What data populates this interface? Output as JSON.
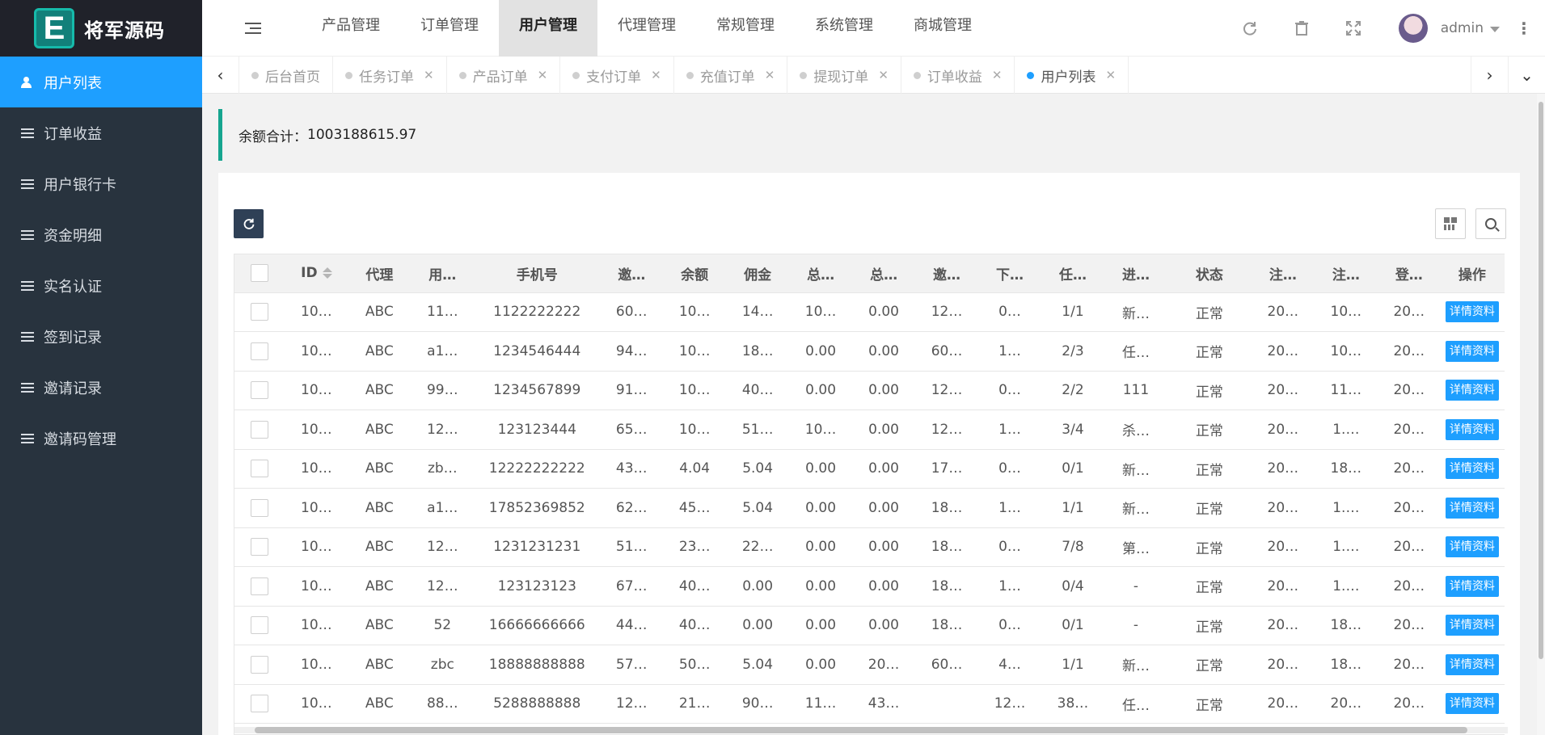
{
  "app": {
    "logo_letter": "E",
    "logo_text": "将军源码"
  },
  "sidebar": {
    "items": [
      {
        "label": "用户列表",
        "active": true
      },
      {
        "label": "订单收益"
      },
      {
        "label": "用户银行卡"
      },
      {
        "label": "资金明细"
      },
      {
        "label": "实名认证"
      },
      {
        "label": "签到记录"
      },
      {
        "label": "邀请记录"
      },
      {
        "label": "邀请码管理"
      }
    ]
  },
  "header": {
    "nav": [
      "产品管理",
      "订单管理",
      "用户管理",
      "代理管理",
      "常规管理",
      "系统管理",
      "商城管理"
    ],
    "active_nav": "用户管理",
    "username": "admin",
    "icons": [
      "refresh-icon",
      "trash-icon",
      "fullscreen-icon",
      "more-icon"
    ]
  },
  "tabs": [
    {
      "label": "后台首页",
      "closable": false
    },
    {
      "label": "任务订单",
      "closable": true
    },
    {
      "label": "产品订单",
      "closable": true
    },
    {
      "label": "支付订单",
      "closable": true
    },
    {
      "label": "充值订单",
      "closable": true
    },
    {
      "label": "提现订单",
      "closable": true
    },
    {
      "label": "订单收益",
      "closable": true
    },
    {
      "label": "用户列表",
      "closable": true,
      "active": true
    }
  ],
  "notice": {
    "label": "余额合计：",
    "value": "1003188615.97"
  },
  "table": {
    "columns": [
      "ID",
      "代理",
      "用…",
      "手机号",
      "邀…",
      "余额",
      "佣金",
      "总…",
      "总…",
      "邀…",
      "下…",
      "任…",
      "进…",
      "状态",
      "注…",
      "注…",
      "登…",
      "操作"
    ],
    "action_label": "详情资料",
    "rows": [
      [
        "10…",
        "ABC",
        "11…",
        "1122222222",
        "60…",
        "10…",
        "14…",
        "10…",
        "0.00",
        "12…",
        "0…",
        "1/1",
        "新…",
        "正常",
        "20…",
        "10…",
        "20…"
      ],
      [
        "10…",
        "ABC",
        "a1…",
        "1234546444",
        "94…",
        "10…",
        "18…",
        "0.00",
        "0.00",
        "60…",
        "1…",
        "2/3",
        "任…",
        "正常",
        "20…",
        "10…",
        "20…"
      ],
      [
        "10…",
        "ABC",
        "99…",
        "1234567899",
        "91…",
        "10…",
        "40…",
        "0.00",
        "0.00",
        "12…",
        "0…",
        "2/2",
        "111",
        "正常",
        "20…",
        "11…",
        "20…"
      ],
      [
        "10…",
        "ABC",
        "12…",
        "123123444",
        "65…",
        "10…",
        "51…",
        "10…",
        "0.00",
        "12…",
        "1…",
        "3/4",
        "杀…",
        "正常",
        "20…",
        "1.…",
        "20…"
      ],
      [
        "10…",
        "ABC",
        "zb…",
        "12222222222",
        "43…",
        "4.04",
        "5.04",
        "0.00",
        "0.00",
        "17…",
        "0…",
        "0/1",
        "新…",
        "正常",
        "20…",
        "18…",
        "20…"
      ],
      [
        "10…",
        "ABC",
        "a1…",
        "17852369852",
        "62…",
        "45…",
        "5.04",
        "0.00",
        "0.00",
        "18…",
        "1…",
        "1/1",
        "新…",
        "正常",
        "20…",
        "1.…",
        "20…"
      ],
      [
        "10…",
        "ABC",
        "12…",
        "1231231231",
        "51…",
        "23…",
        "22…",
        "0.00",
        "0.00",
        "18…",
        "0…",
        "7/8",
        "第…",
        "正常",
        "20…",
        "1.…",
        "20…"
      ],
      [
        "10…",
        "ABC",
        "12…",
        "123123123",
        "67…",
        "40…",
        "0.00",
        "0.00",
        "0.00",
        "18…",
        "1…",
        "0/4",
        "-",
        "正常",
        "20…",
        "1.…",
        "20…"
      ],
      [
        "10…",
        "ABC",
        "52",
        "16666666666",
        "44…",
        "40…",
        "0.00",
        "0.00",
        "0.00",
        "18…",
        "0…",
        "0/1",
        "-",
        "正常",
        "20…",
        "18…",
        "20…"
      ],
      [
        "10…",
        "ABC",
        "zbc",
        "18888888888",
        "57…",
        "50…",
        "5.04",
        "0.00",
        "20…",
        "60…",
        "4…",
        "1/1",
        "新…",
        "正常",
        "20…",
        "18…",
        "20…"
      ],
      [
        "10…",
        "ABC",
        "88…",
        "5288888888",
        "12…",
        "21…",
        "90…",
        "11…",
        "43…",
        "",
        "12…",
        "38…",
        "任…",
        "正常",
        "20…",
        "20…",
        "20…"
      ]
    ]
  }
}
